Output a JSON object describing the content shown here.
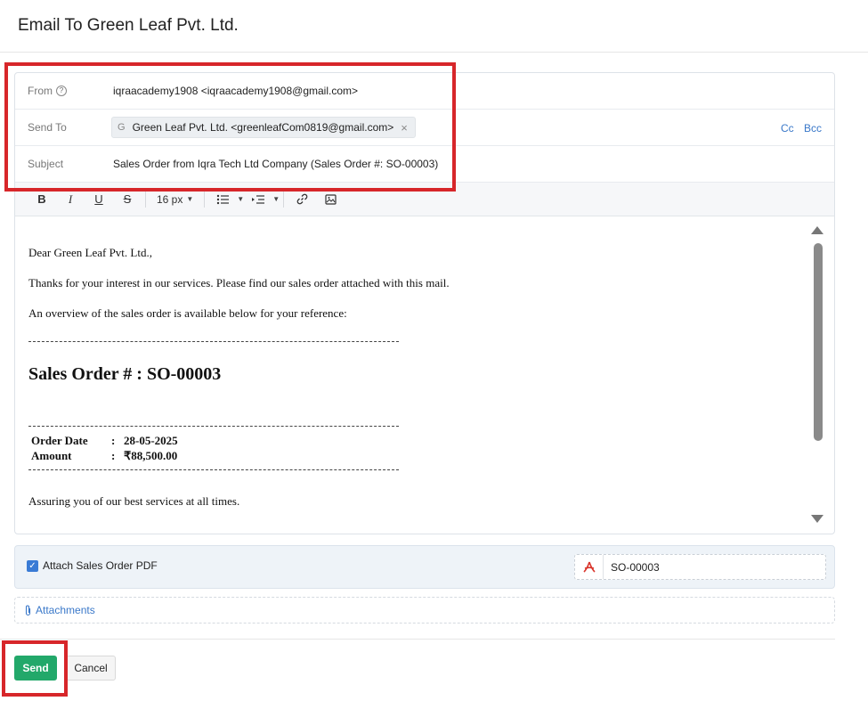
{
  "title": "Email To Green Leaf Pvt. Ltd.",
  "from": {
    "label": "From",
    "value": "iqraacademy1908 <iqraacademy1908@gmail.com>"
  },
  "send_to": {
    "label": "Send To",
    "chip_initial": "G",
    "chip_text": "Green Leaf Pvt. Ltd. <greenleafCom0819@gmail.com>",
    "cc": "Cc",
    "bcc": "Bcc"
  },
  "subject": {
    "label": "Subject",
    "value": "Sales Order from Iqra Tech Ltd Company (Sales Order #: SO-00003)"
  },
  "toolbar": {
    "bold": "B",
    "italic": "I",
    "underline": "U",
    "strike": "S",
    "font_size": "16 px"
  },
  "body": {
    "greeting": "Dear Green Leaf Pvt. Ltd.,",
    "line1": "Thanks for your interest in our services. Please find our sales order attached with this mail.",
    "line2": "An overview of the sales order is available below for your reference:",
    "heading": "Sales Order # : SO-00003",
    "order_date_label": "Order Date",
    "order_date_value": "28-05-2025",
    "amount_label": "Amount",
    "amount_value": "₹88,500.00",
    "separator": ":",
    "closing": "Assuring you of our best services at all times."
  },
  "attach": {
    "label": "Attach Sales Order PDF",
    "checked": true,
    "file_name": "SO-00003"
  },
  "attachments_link": "Attachments",
  "buttons": {
    "send": "Send",
    "cancel": "Cancel"
  },
  "colors": {
    "highlight": "#d7262a",
    "send": "#22a86a",
    "link": "#3a78c9"
  }
}
